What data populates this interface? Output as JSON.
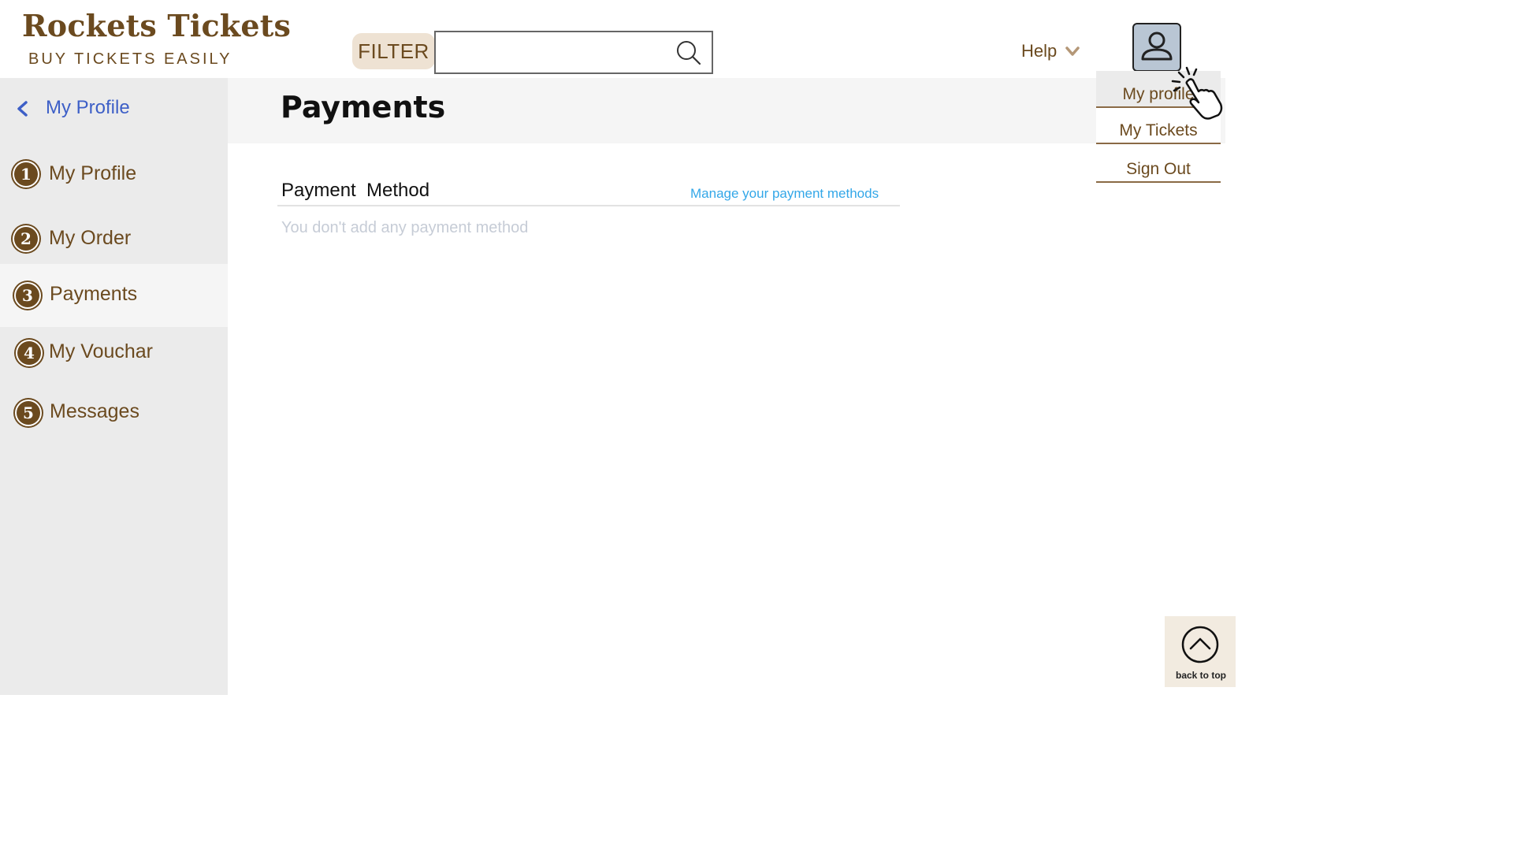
{
  "header": {
    "brand_title": "Rockets Tickets",
    "brand_subtitle": "BUY TICKETS EASILY",
    "filter_label": "FILTER",
    "search_placeholder": "",
    "help_label": "Help"
  },
  "sidebar": {
    "back_label": "My Profile",
    "items": [
      {
        "number": "1",
        "label": "My Profile",
        "active": false
      },
      {
        "number": "2",
        "label": "My Order",
        "active": false
      },
      {
        "number": "3",
        "label": "Payments",
        "active": true
      },
      {
        "number": "4",
        "label": "My Vouchar",
        "active": false
      },
      {
        "number": "5",
        "label": "Messages",
        "active": false
      }
    ]
  },
  "main": {
    "title": "Payments",
    "payment_method_label": "Payment  Method",
    "manage_link": "Manage your payment methods",
    "empty_message": "You don't add any payment method"
  },
  "user_menu": {
    "items": [
      "My profile",
      "My Tickets",
      "Sign Out"
    ]
  },
  "back_to_top": "back to top",
  "colors": {
    "brand": "#6b4a1f",
    "link_blue": "#33a7e8",
    "back_link": "#3d5fc7",
    "sidebar_bg": "#ebebeb",
    "filter_bg": "#eee2d3"
  }
}
